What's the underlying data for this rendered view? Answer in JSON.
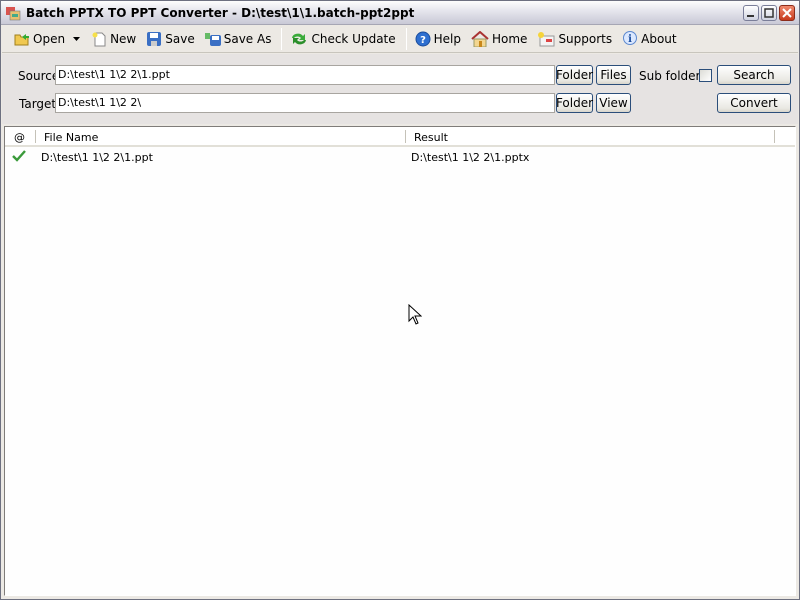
{
  "window": {
    "title": "Batch PPTX TO PPT Converter - D:\\test\\1\\1.batch-ppt2ppt"
  },
  "toolbar": {
    "open": "Open",
    "new": "New",
    "save": "Save",
    "save_as": "Save As",
    "check_update": "Check Update",
    "help": "Help",
    "home": "Home",
    "supports": "Supports",
    "about": "About"
  },
  "form": {
    "source_label": "Source",
    "source_value": "D:\\test\\1 1\\2 2\\1.ppt",
    "target_label": "Target",
    "target_value": "D:\\test\\1 1\\2 2\\",
    "folder_button": "Folder",
    "files_button": "Files",
    "view_button": "View",
    "subfolders_label": "Sub folders",
    "subfolders_checked": false,
    "search_button": "Search",
    "convert_button": "Convert"
  },
  "list": {
    "columns": [
      "@",
      "File Name",
      "Result"
    ],
    "rows": [
      {
        "status": "success",
        "file_name": "D:\\test\\1 1\\2 2\\1.ppt",
        "result": "D:\\test\\1 1\\2 2\\1.pptx"
      }
    ]
  }
}
